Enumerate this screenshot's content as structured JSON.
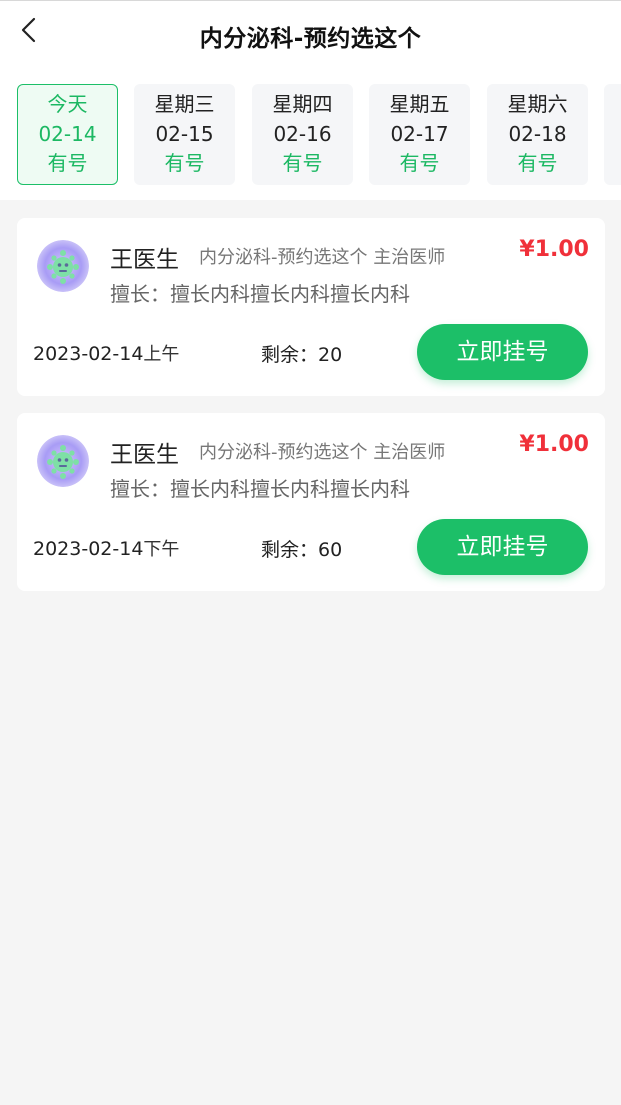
{
  "header": {
    "title": "内分泌科-预约选这个",
    "back_icon": "chevron-left-icon"
  },
  "dates": [
    {
      "week": "今天",
      "date": "02-14",
      "status": "有号",
      "active": true
    },
    {
      "week": "星期三",
      "date": "02-15",
      "status": "有号",
      "active": false
    },
    {
      "week": "星期四",
      "date": "02-16",
      "status": "有号",
      "active": false
    },
    {
      "week": "星期五",
      "date": "02-17",
      "status": "有号",
      "active": false
    },
    {
      "week": "星期六",
      "date": "02-18",
      "status": "有号",
      "active": false
    }
  ],
  "slots": [
    {
      "doctor_name": "王医生",
      "dept_title": "内分泌科-预约选这个 主治医师",
      "price": "¥1.00",
      "skill": "擅长：擅长内科擅长内科擅长内科",
      "date": "2023-02-14",
      "period": "上午",
      "remain_label": "剩余：",
      "remain": "20",
      "button_label": "立即挂号"
    },
    {
      "doctor_name": "王医生",
      "dept_title": "内分泌科-预约选这个 主治医师",
      "price": "¥1.00",
      "skill": "擅长：擅长内科擅长内科擅长内科",
      "date": "2023-02-14",
      "period": "下午",
      "remain_label": "剩余：",
      "remain": "60",
      "button_label": "立即挂号"
    }
  ],
  "colors": {
    "accent": "#1cbf68",
    "price": "#f0303a",
    "background": "#f5f5f5"
  }
}
